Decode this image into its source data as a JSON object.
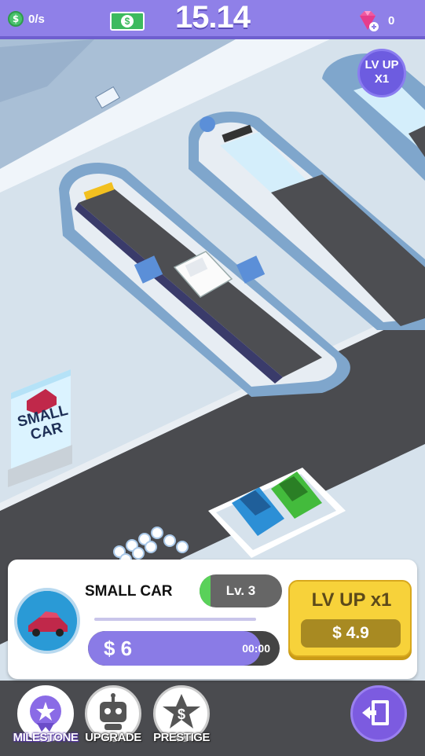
{
  "topbar": {
    "income_rate": "0/s",
    "money": "15.14",
    "gems": "0",
    "icons": [
      "coin-icon",
      "cash-bill-icon",
      "diamond-icon"
    ]
  },
  "lv_up_badge": {
    "line1": "LV UP",
    "line2": "X1"
  },
  "sign": {
    "line1": "SMALL",
    "line2": "CAR"
  },
  "card": {
    "car_name": "SMALL CAR",
    "level": "Lv. 3",
    "level_progress": 0.13,
    "earn_value": "$ 6",
    "earn_progress": 0.9,
    "timer": "00:00",
    "lvup_title": "LV UP x1",
    "lvup_price": "$ 4.9"
  },
  "nav": {
    "milestone": "MILESTONE",
    "upgrade": "UPGRADE",
    "prestige": "PRESTIGE"
  },
  "colors": {
    "accent": "#8f80e8",
    "button_yellow": "#f7d23a",
    "progress": "#8a7be6"
  }
}
